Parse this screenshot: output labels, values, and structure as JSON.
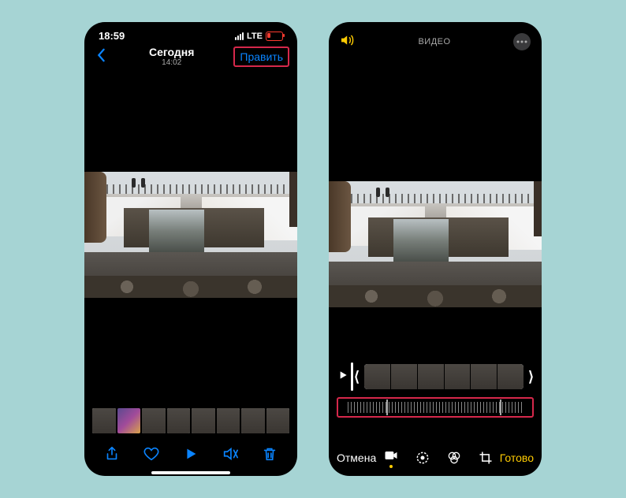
{
  "status": {
    "time": "18:59",
    "carrier": "LTE"
  },
  "left": {
    "title": "Сегодня",
    "subtitle": "14:02",
    "edit": "Править"
  },
  "right": {
    "title": "ВИДЕО",
    "cancel": "Отмена",
    "done": "Готово"
  }
}
